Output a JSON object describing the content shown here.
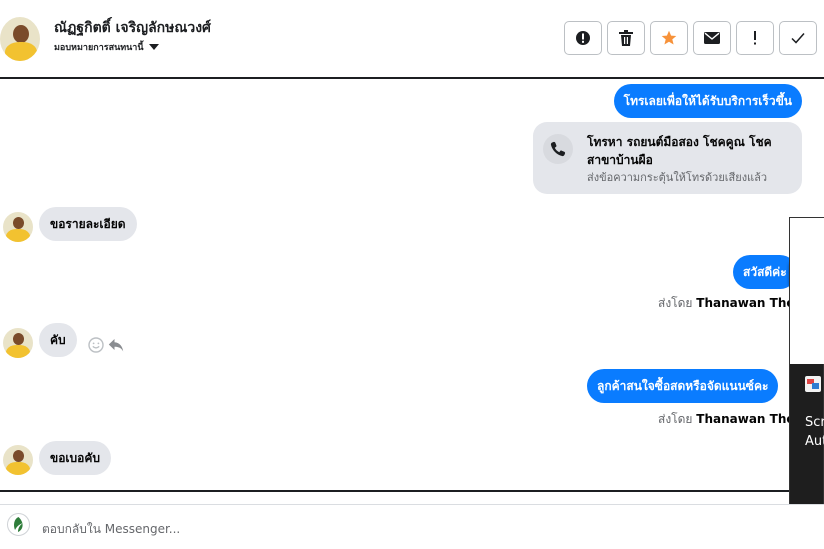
{
  "header": {
    "contact_name": "ณัฏฐกิตติ์ เจริญลักษณวงศ์",
    "assign_label": "มอบหมายการสนทนานี้"
  },
  "toolbar": {
    "buttons": [
      {
        "icon": "report-icon"
      },
      {
        "icon": "trash-icon"
      },
      {
        "icon": "star-icon",
        "color": "#f7923a"
      },
      {
        "icon": "mail-icon"
      },
      {
        "icon": "exclamation-icon"
      },
      {
        "icon": "checkmark-icon"
      }
    ]
  },
  "messages": {
    "call_cta": "โทรเลยเพื่อให้ได้รับบริการเร็วขึ้น",
    "call_card_title": "โทรหา รถยนต์มือสอง โชคคูณ โชค สาขาบ้านผือ",
    "call_card_sub": "ส่งข้อความกระตุ้นให้โทรด้วยเสียงแล้ว",
    "in_1": "ขอรายละเอียด",
    "out_1": "สวัสดีค่ะ",
    "sent_by_label": "ส่งโดย",
    "sent_by_name": "Thanawan Thon",
    "in_2": "คับ",
    "out_2": "ลูกค้าสนใจซื้อสดหรือจัดแนนซ์คะ",
    "in_3": "ขอเบอคับ"
  },
  "side_panel": {
    "line1": "Scr",
    "line2": "Aut"
  },
  "composer": {
    "placeholder": "ตอบกลับใน Messenger..."
  },
  "colors": {
    "outgoing": "#0a7cff",
    "incoming": "#e4e6eb",
    "accent_star": "#f7923a"
  }
}
